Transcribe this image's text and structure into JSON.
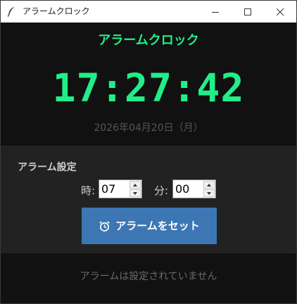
{
  "window": {
    "title": "アラームクロック"
  },
  "header": {
    "title": "アラームクロック"
  },
  "clock": {
    "time": "17:27:42",
    "date": "2026年04月20日（月）"
  },
  "alarm_panel": {
    "section_label": "アラーム設定",
    "hour_label": "時:",
    "hour_value": "07",
    "minute_label": "分:",
    "minute_value": "00",
    "set_button_label": "アラームをセット"
  },
  "status": {
    "text": "アラームは設定されていません"
  },
  "colors": {
    "accent": "#22ee88",
    "button": "#3d77b3",
    "background": "#111111",
    "panel": "#222222"
  }
}
